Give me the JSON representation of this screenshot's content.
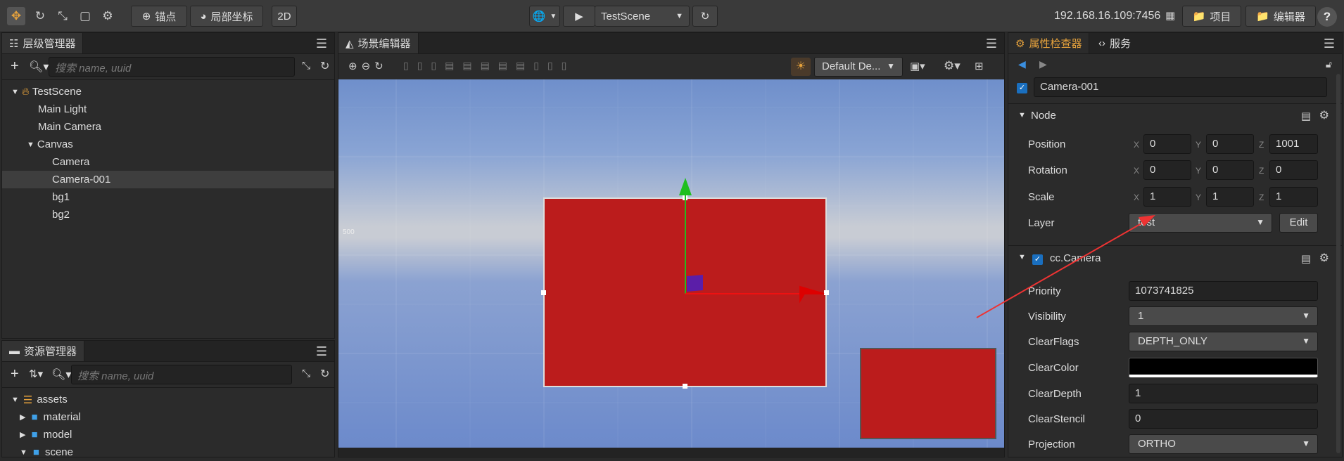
{
  "top": {
    "anchor_label": "锚点",
    "local_coord_label": "局部坐标",
    "mode_2d": "2D",
    "scene_name": "TestScene",
    "ip": "192.168.16.109:7456",
    "project_btn": "项目",
    "editor_btn": "编辑器",
    "help": "?"
  },
  "hierarchy": {
    "title": "层级管理器",
    "search_placeholder": "搜索 name, uuid",
    "items": [
      {
        "label": "TestScene"
      },
      {
        "label": "Main Light"
      },
      {
        "label": "Main Camera"
      },
      {
        "label": "Canvas"
      },
      {
        "label": "Camera"
      },
      {
        "label": "Camera-001"
      },
      {
        "label": "bg1"
      },
      {
        "label": "bg2"
      }
    ]
  },
  "assets": {
    "title": "资源管理器",
    "search_placeholder": "搜索 name, uuid",
    "items": [
      {
        "label": "assets"
      },
      {
        "label": "material"
      },
      {
        "label": "model"
      },
      {
        "label": "scene"
      }
    ]
  },
  "scene": {
    "title": "场景编辑器",
    "camera_select": "Default De...",
    "grid_label_500": "500"
  },
  "inspector": {
    "tab_inspector": "属性检查器",
    "tab_service": "服务",
    "node_name": "Camera-001",
    "node_section": "Node",
    "position": {
      "label": "Position",
      "x": "0",
      "y": "0",
      "z": "1001"
    },
    "rotation": {
      "label": "Rotation",
      "x": "0",
      "y": "0",
      "z": "0"
    },
    "scale": {
      "label": "Scale",
      "x": "1",
      "y": "1",
      "z": "1"
    },
    "layer": {
      "label": "Layer",
      "value": "test",
      "edit": "Edit"
    },
    "axis": {
      "x": "X",
      "y": "Y",
      "z": "Z"
    },
    "camera_section": "cc.Camera",
    "priority": {
      "label": "Priority",
      "value": "1073741825"
    },
    "visibility": {
      "label": "Visibility",
      "value": "1"
    },
    "clearflags": {
      "label": "ClearFlags",
      "value": "DEPTH_ONLY"
    },
    "clearcolor": {
      "label": "ClearColor",
      "value": "#000000"
    },
    "cleardepth": {
      "label": "ClearDepth",
      "value": "1"
    },
    "clearstencil": {
      "label": "ClearStencil",
      "value": "0"
    },
    "projection": {
      "label": "Projection",
      "value": "ORTHO"
    }
  },
  "colors": {
    "accent": "#e6a23c",
    "red_sprite": "#bb1c1c",
    "sky": "#6b8ccf",
    "active_tab": "#1f6fb8"
  }
}
